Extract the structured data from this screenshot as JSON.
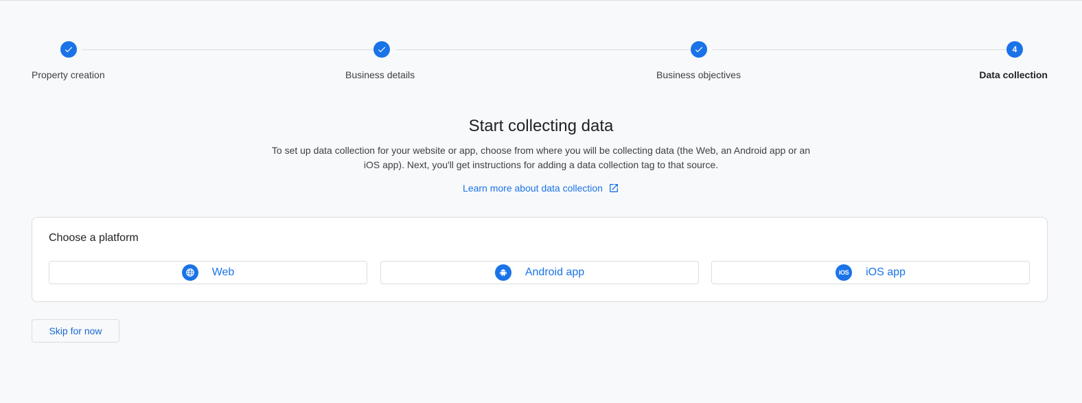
{
  "stepper": {
    "steps": [
      {
        "label": "Property creation",
        "status": "complete"
      },
      {
        "label": "Business details",
        "status": "complete"
      },
      {
        "label": "Business objectives",
        "status": "complete"
      },
      {
        "label": "Data collection",
        "status": "current",
        "number": "4"
      }
    ]
  },
  "main": {
    "title": "Start collecting data",
    "description": "To set up data collection for your website or app, choose from where you will be collecting data (the Web, an Android app or an iOS app). Next, you'll get instructions for adding a data collection tag to that source.",
    "learn_more_label": "Learn more about data collection"
  },
  "platform_card": {
    "title": "Choose a platform",
    "platforms": [
      {
        "label": "Web",
        "icon": "globe-icon"
      },
      {
        "label": "Android app",
        "icon": "android-icon"
      },
      {
        "label": "iOS app",
        "icon": "ios-icon",
        "icon_text": "iOS"
      }
    ]
  },
  "footer": {
    "skip_label": "Skip for now"
  },
  "colors": {
    "accent": "#1a73e8",
    "background": "#f8f9fa",
    "border": "#dadce0"
  }
}
